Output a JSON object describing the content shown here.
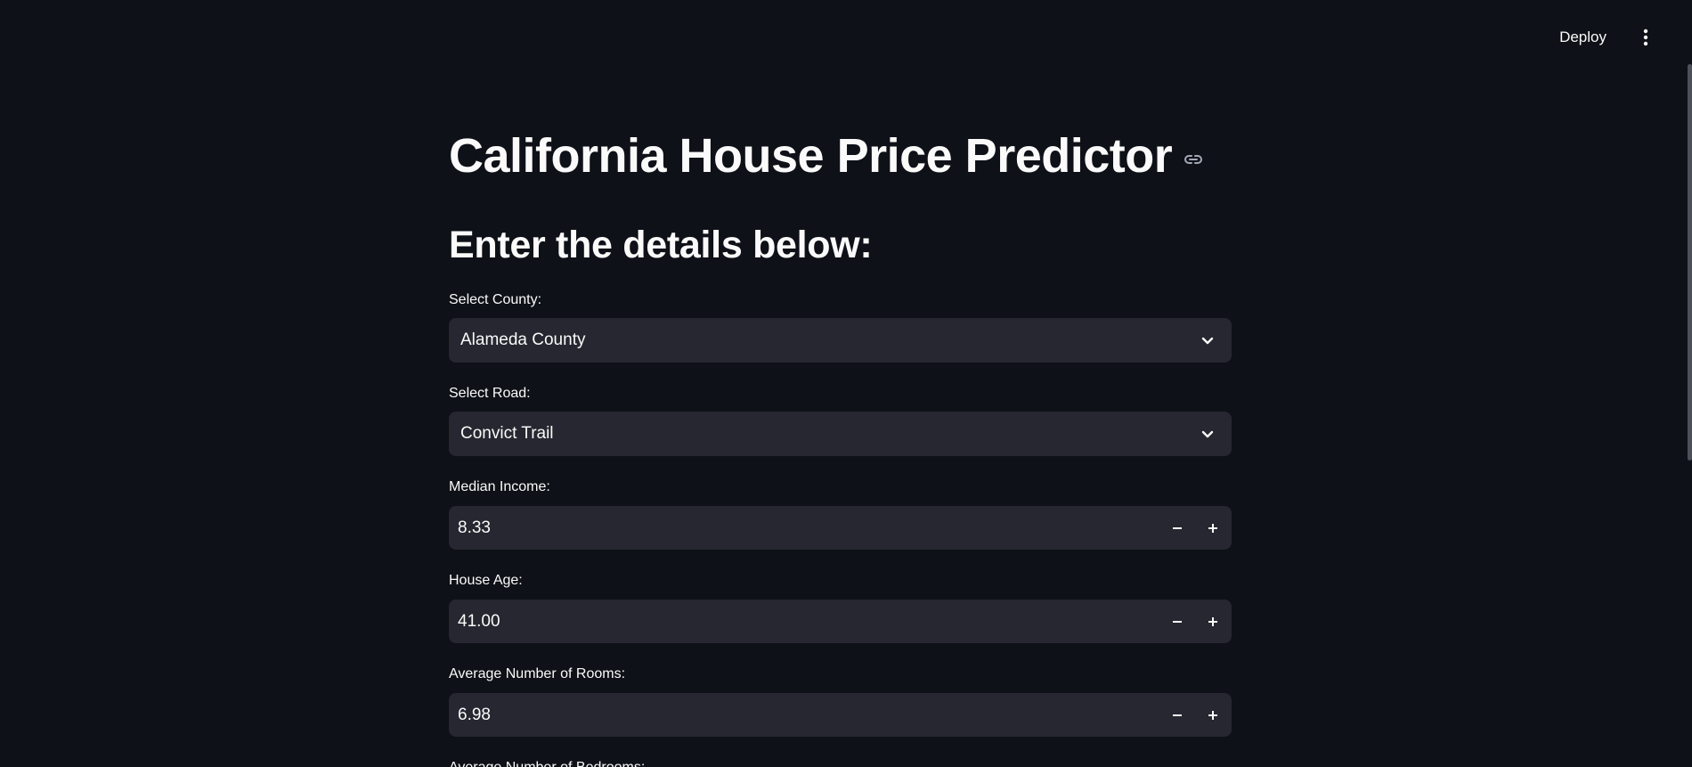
{
  "header": {
    "deploy_label": "Deploy",
    "menu_icon": "vertical-ellipsis-icon"
  },
  "main": {
    "title": "California House Price Predictor",
    "subtitle": "Enter the details below:",
    "county": {
      "label": "Select County:",
      "value": "Alameda County"
    },
    "road": {
      "label": "Select Road:",
      "value": "Convict Trail"
    },
    "median_income": {
      "label": "Median Income:",
      "value": "8.33"
    },
    "house_age": {
      "label": "House Age:",
      "value": "41.00"
    },
    "avg_rooms": {
      "label": "Average Number of Rooms:",
      "value": "6.98"
    },
    "avg_bedrooms": {
      "label": "Average Number of Bedrooms:"
    }
  },
  "colors": {
    "background": "#0e1117",
    "input_bg": "#262730",
    "text": "#fafafa"
  }
}
